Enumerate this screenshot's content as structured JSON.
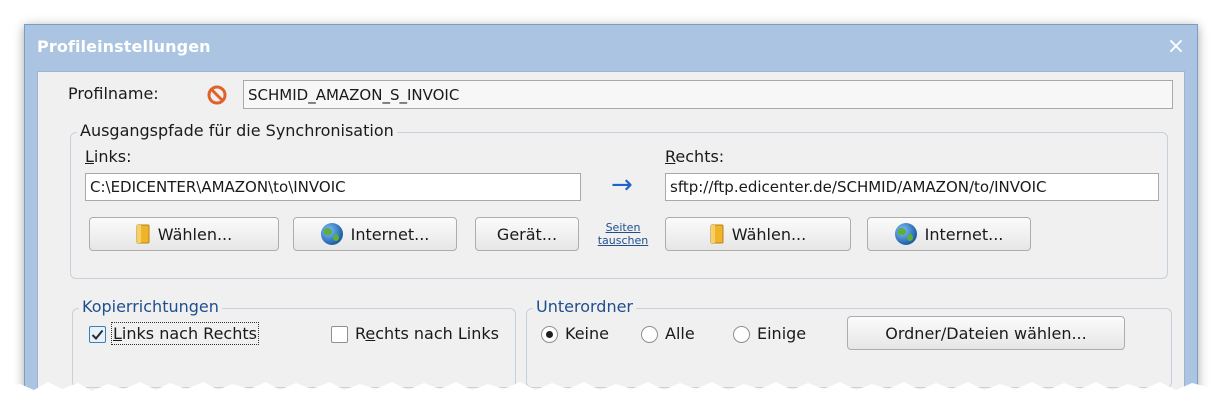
{
  "window": {
    "title": "Profileinstellungen",
    "close_label": "×"
  },
  "profile": {
    "label": "Profilname:",
    "value": "SCHMID_AMAZON_S_INVOIC"
  },
  "sync_paths": {
    "group_title": "Ausgangspfade für die Synchronisation",
    "left": {
      "label_accel": "L",
      "label_rest": "inks:",
      "path": "C:\\EDICENTER\\AMAZON\\to\\INVOIC",
      "choose_button": "Wählen...",
      "internet_button": "Internet...",
      "device_button": "Gerät..."
    },
    "arrow": "→",
    "swap_link_line1": "Seiten",
    "swap_link_line2": "tauschen",
    "right": {
      "label_accel": "R",
      "label_rest": "echts:",
      "path": "sftp://ftp.edicenter.de/SCHMID/AMAZON/to/INVOIC",
      "choose_button": "Wählen...",
      "internet_button": "Internet..."
    }
  },
  "copy_directions": {
    "group_title": "Kopierrichtungen",
    "left_to_right": {
      "accel": "L",
      "rest": "inks nach Rechts",
      "checked": true
    },
    "right_to_left": {
      "pre": "R",
      "accel": "e",
      "rest": "chts nach Links",
      "checked": false
    }
  },
  "subfolders": {
    "group_title": "Unterordner",
    "options": [
      "Keine",
      "Alle",
      "Einige"
    ],
    "selected": "Keine",
    "choose_button": "Ordner/Dateien wählen..."
  },
  "colors": {
    "window_frame": "#aac4e2",
    "client_bg": "#f0f0f0",
    "group_title_blue": "#1f4e8c",
    "arrow_blue": "#1e64c8",
    "error_icon": "#e0622a"
  }
}
